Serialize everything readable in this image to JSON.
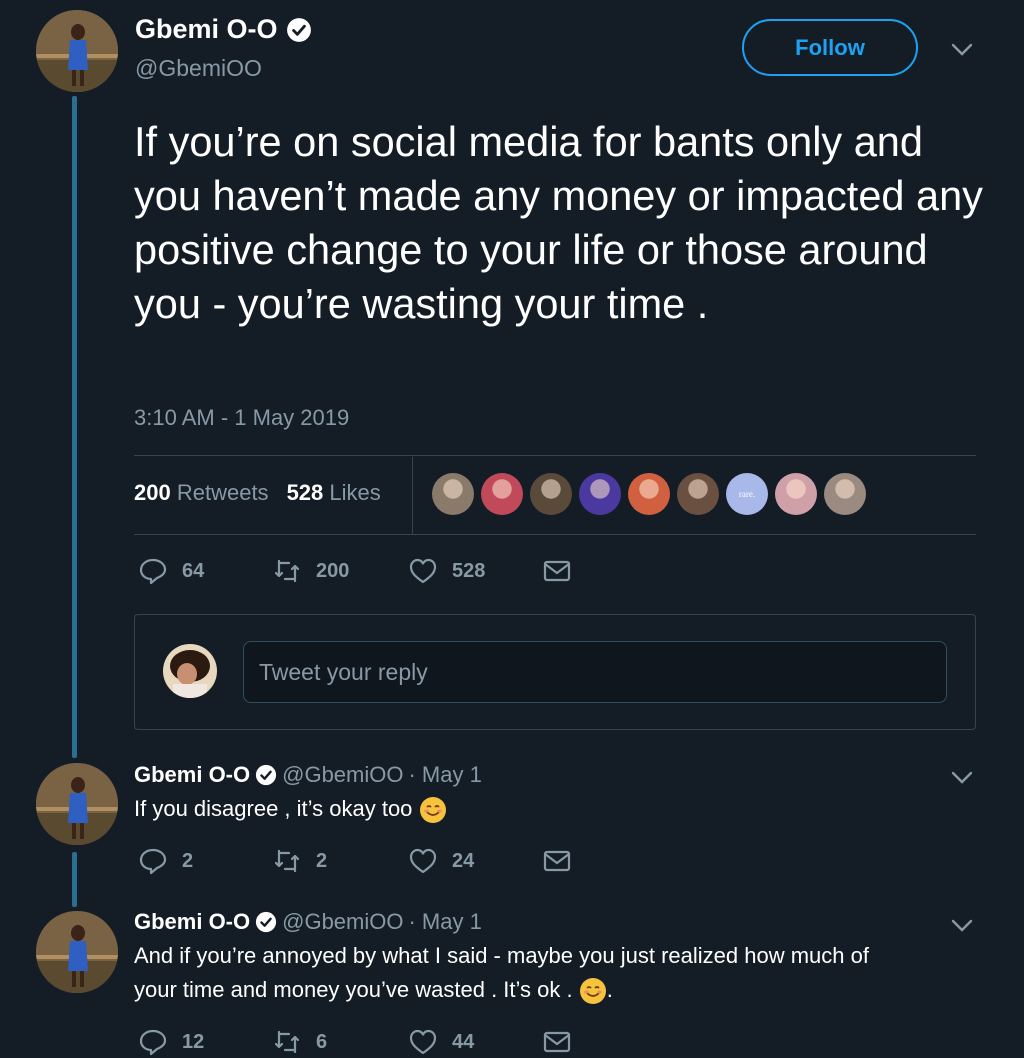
{
  "main_tweet": {
    "author_name": "Gbemi O-O",
    "handle": "@GbemiOO",
    "follow_label": "Follow",
    "text": "If you’re on social media for bants only and you haven’t made any money or impacted any positive change to your life or those around you - you’re wasting your time .",
    "timestamp": "3:10 AM - 1 May 2019",
    "retweets_count": "200",
    "retweets_label": "Retweets",
    "likes_count": "528",
    "likes_label": "Likes",
    "likers": [
      {
        "icon": "avatar-1",
        "color": "#8a7a6a"
      },
      {
        "icon": "avatar-2",
        "color": "#c04a5a"
      },
      {
        "icon": "avatar-3",
        "color": "#5a4a3a"
      },
      {
        "icon": "avatar-4",
        "color": "#4a3aa0"
      },
      {
        "icon": "avatar-5",
        "color": "#d06040"
      },
      {
        "icon": "avatar-6",
        "color": "#6a5040"
      },
      {
        "icon": "avatar-7",
        "color": "#a8b8e8",
        "text": "rare."
      },
      {
        "icon": "avatar-8",
        "color": "#d0a0a8"
      },
      {
        "icon": "avatar-9",
        "color": "#9a8a80"
      }
    ],
    "actions": {
      "replies": "64",
      "retweets": "200",
      "likes": "528"
    }
  },
  "reply_composer": {
    "placeholder": "Tweet your reply"
  },
  "replies": [
    {
      "author_name": "Gbemi O-O",
      "handle": "@GbemiOO",
      "date": "· May 1",
      "text": "If you disagree , it’s okay too",
      "actions": {
        "replies": "2",
        "retweets": "2",
        "likes": "24"
      }
    },
    {
      "author_name": "Gbemi O-O",
      "handle": "@GbemiOO",
      "date": "· May 1",
      "text_line1": "And if you’re annoyed by what I said - maybe you just realized how much of",
      "text_line2": "your time and money you’ve wasted . It’s ok .",
      "text_suffix": ".",
      "actions": {
        "replies": "12",
        "retweets": "6",
        "likes": "44"
      }
    }
  ],
  "colors": {
    "background": "#141d26",
    "accent": "#1da1f2",
    "muted": "#8899a6",
    "thread": "#2a6f8f"
  }
}
